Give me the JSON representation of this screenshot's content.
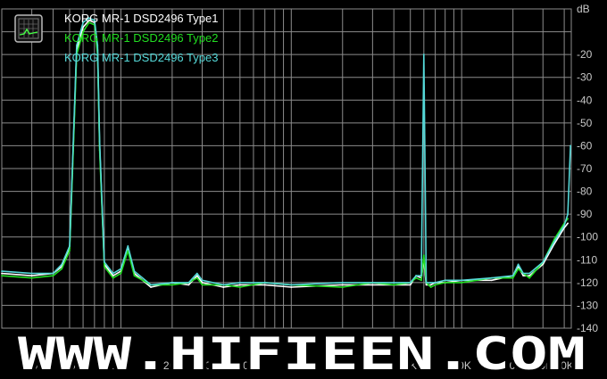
{
  "chart_data": {
    "type": "line",
    "title": "",
    "xlabel": "",
    "ylabel": "dB",
    "x_scale": "log",
    "xlim": [
      20,
      44000
    ],
    "ylim": [
      -140,
      0
    ],
    "grid": true,
    "legend_placement": "top-left",
    "x_ticks": [
      {
        "x": 30,
        "label": "30"
      },
      {
        "x": 50,
        "label": "50"
      },
      {
        "x": 100,
        "label": "100"
      },
      {
        "x": 200,
        "label": "200"
      },
      {
        "x": 300,
        "label": "300"
      },
      {
        "x": 500,
        "label": "500"
      },
      {
        "x": 1000,
        "label": "1K"
      },
      {
        "x": 2000,
        "label": "2K"
      },
      {
        "x": 5000,
        "label": "5K"
      },
      {
        "x": 10000,
        "label": "10K"
      },
      {
        "x": 20000,
        "label": "20K"
      },
      {
        "x": 30000,
        "label": "30K"
      },
      {
        "x": 40000,
        "label": "40K"
      }
    ],
    "y_ticks": [
      {
        "y": 0,
        "label": "dB"
      },
      {
        "y": -20,
        "label": "-20"
      },
      {
        "y": -30,
        "label": "-30"
      },
      {
        "y": -40,
        "label": "-40"
      },
      {
        "y": -50,
        "label": "-50"
      },
      {
        "y": -60,
        "label": "-60"
      },
      {
        "y": -70,
        "label": "-70"
      },
      {
        "y": -80,
        "label": "-80"
      },
      {
        "y": -90,
        "label": "-90"
      },
      {
        "y": -100,
        "label": "-100"
      },
      {
        "y": -110,
        "label": "-110"
      },
      {
        "y": -120,
        "label": "-120"
      },
      {
        "y": -130,
        "label": "-130"
      },
      {
        "y": -140,
        "label": "-140"
      }
    ],
    "series": [
      {
        "name": "KORG MR-1 DSD2496 Type1",
        "color": "#ffffff",
        "x": [
          20,
          30,
          40,
          45,
          50,
          52,
          55,
          60,
          65,
          70,
          73,
          75,
          80,
          90,
          100,
          110,
          120,
          150,
          200,
          250,
          280,
          300,
          400,
          500,
          700,
          1000,
          2000,
          3000,
          4000,
          5000,
          5400,
          5800,
          6000,
          6200,
          6600,
          7000,
          8000,
          10000,
          15000,
          20000,
          21500,
          23000,
          25000,
          30000,
          35000,
          40000,
          42000
        ],
        "y": [
          -116,
          -117,
          -116,
          -113,
          -105,
          -70,
          -18,
          -8,
          -5,
          -6,
          -18,
          -60,
          -112,
          -117,
          -115,
          -105,
          -116,
          -122,
          -120,
          -121,
          -117,
          -120,
          -122,
          -121,
          -121,
          -122,
          -121,
          -121,
          -121,
          -121,
          -117,
          -118,
          -110,
          -121,
          -121,
          -120,
          -120,
          -119,
          -119,
          -117,
          -113,
          -117,
          -117,
          -112,
          -103,
          -96,
          -94
        ]
      },
      {
        "name": "KORG MR-1 DSD2496 Type2",
        "color": "#22dd22",
        "x": [
          20,
          30,
          40,
          45,
          50,
          52,
          55,
          60,
          65,
          70,
          73,
          75,
          80,
          90,
          100,
          110,
          120,
          150,
          200,
          250,
          280,
          300,
          400,
          500,
          700,
          1000,
          2000,
          3000,
          4000,
          5000,
          5400,
          5800,
          6000,
          6200,
          6600,
          7000,
          8000,
          10000,
          15000,
          20000,
          21500,
          23000,
          25000,
          30000,
          35000,
          40000,
          42000
        ],
        "y": [
          -117,
          -118,
          -117,
          -114,
          -106,
          -72,
          -20,
          -10,
          -6,
          -7,
          -20,
          -62,
          -113,
          -118,
          -116,
          -106,
          -117,
          -121,
          -121,
          -120,
          -118,
          -121,
          -121,
          -122,
          -120,
          -121,
          -122,
          -120,
          -121,
          -120,
          -118,
          -119,
          -108,
          -120,
          -122,
          -121,
          -120,
          -120,
          -118,
          -118,
          -114,
          -116,
          -118,
          -111,
          -101,
          -94,
          -92
        ]
      },
      {
        "name": "KORG MR-1 DSD2496 Type3",
        "color": "#55d8d8",
        "x": [
          20,
          30,
          40,
          45,
          50,
          52,
          55,
          60,
          65,
          70,
          73,
          75,
          80,
          90,
          100,
          110,
          120,
          150,
          200,
          250,
          280,
          300,
          400,
          500,
          700,
          1000,
          2000,
          3000,
          4000,
          5000,
          5400,
          5800,
          6000,
          6200,
          6600,
          7000,
          8000,
          10000,
          15000,
          20000,
          21500,
          23000,
          25000,
          30000,
          35000,
          40000,
          42000,
          43500
        ],
        "y": [
          -115,
          -116,
          -116,
          -112,
          -104,
          -68,
          -16,
          -6,
          -4,
          -5,
          -16,
          -58,
          -111,
          -116,
          -114,
          -104,
          -115,
          -121,
          -120,
          -120,
          -116,
          -119,
          -121,
          -120,
          -120,
          -121,
          -120,
          -120,
          -120,
          -120,
          -117,
          -117,
          -20,
          -120,
          -120,
          -120,
          -119,
          -119,
          -118,
          -117,
          -112,
          -116,
          -116,
          -111,
          -102,
          -95,
          -90,
          -60
        ]
      }
    ]
  },
  "watermark": "WWW.HIFIEEN.COM",
  "colors": {
    "background": "#000000",
    "grid": "#8c8c8c",
    "axis_text": "#c8c8c8"
  }
}
